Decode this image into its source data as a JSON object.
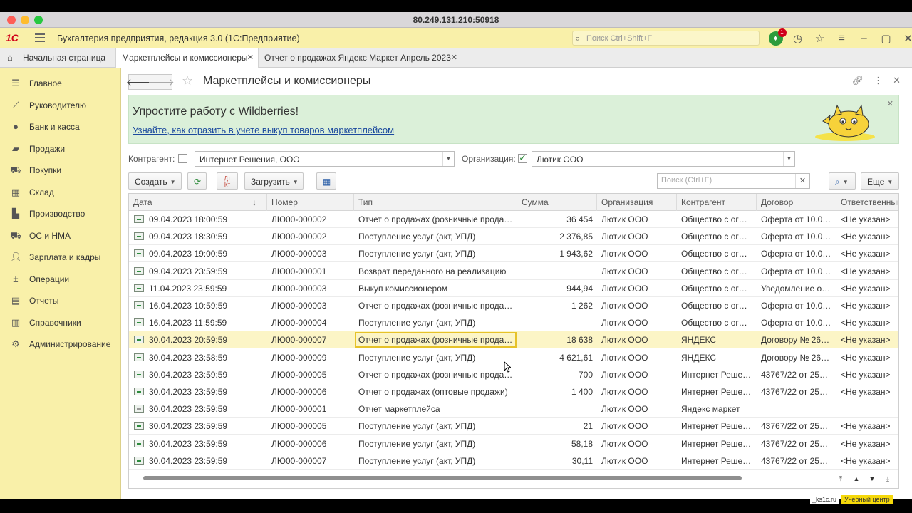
{
  "window": {
    "title": "80.249.131.210:50918"
  },
  "app_header": {
    "logo": "1С",
    "title": "Бухгалтерия предприятия, редакция 3.0  (1С:Предприятие)",
    "search_placeholder": "Поиск Ctrl+Shift+F",
    "notification_count": "1"
  },
  "tabs": [
    {
      "label": "Начальная страница"
    },
    {
      "label": "Маркетплейсы и комиссионеры",
      "close": "✕"
    },
    {
      "label": "Отчет о продажах Яндекс Маркет Апрель 2023",
      "close": "✕"
    }
  ],
  "sidebar": {
    "items": [
      {
        "label": "Главное",
        "icon": "list-icon"
      },
      {
        "label": "Руководителю",
        "icon": "chart-icon"
      },
      {
        "label": "Банк и касса",
        "icon": "coin-icon"
      },
      {
        "label": "Продажи",
        "icon": "bag-icon"
      },
      {
        "label": "Покупки",
        "icon": "cart-icon"
      },
      {
        "label": "Склад",
        "icon": "warehouse-icon"
      },
      {
        "label": "Производство",
        "icon": "factory-icon"
      },
      {
        "label": "ОС и НМА",
        "icon": "truck-icon"
      },
      {
        "label": "Зарплата и кадры",
        "icon": "people-icon"
      },
      {
        "label": "Операции",
        "icon": "dt-kt-icon"
      },
      {
        "label": "Отчеты",
        "icon": "report-icon"
      },
      {
        "label": "Справочники",
        "icon": "book-icon"
      },
      {
        "label": "Администрирование",
        "icon": "gear-icon"
      }
    ]
  },
  "page": {
    "title": "Маркетплейсы и комиссионеры",
    "banner": {
      "title": "Упростите работу с Wildberries!",
      "link": "Узнайте, как отразить в учете выкуп товаров маркетплейсом"
    },
    "filters": {
      "counterparty_label": "Контрагент:",
      "counterparty_value": "Интернет Решения, ООО",
      "organization_label": "Организация:",
      "organization_value": "Лютик ООО"
    },
    "toolbar": {
      "create": "Создать",
      "load": "Загрузить",
      "search_placeholder": "Поиск (Ctrl+F)",
      "more": "Еще"
    }
  },
  "table": {
    "columns": [
      "Дата",
      "Номер",
      "Тип",
      "Сумма",
      "Организация",
      "Контрагент",
      "Договор",
      "Ответственный"
    ],
    "rows": [
      {
        "date": "09.04.2023 18:00:59",
        "num": "ЛЮ00-000002",
        "type": "Отчет о продажах (розничные прода…",
        "sum": "36 454",
        "org": "Лютик ООО",
        "cp": "Общество с ог…",
        "contract": "Оферта от 10.0…",
        "resp": "<Не указан>"
      },
      {
        "date": "09.04.2023 18:30:59",
        "num": "ЛЮ00-000002",
        "type": "Поступление услуг (акт, УПД)",
        "sum": "2 376,85",
        "org": "Лютик ООО",
        "cp": "Общество с ог…",
        "contract": "Оферта от 10.0…",
        "resp": "<Не указан>"
      },
      {
        "date": "09.04.2023 19:00:59",
        "num": "ЛЮ00-000003",
        "type": "Поступление услуг (акт, УПД)",
        "sum": "1 943,62",
        "org": "Лютик ООО",
        "cp": "Общество с ог…",
        "contract": "Оферта от 10.0…",
        "resp": "<Не указан>"
      },
      {
        "date": "09.04.2023 23:59:59",
        "num": "ЛЮ00-000001",
        "type": "Возврат переданного на реализацию",
        "sum": "",
        "org": "Лютик ООО",
        "cp": "Общество с ог…",
        "contract": "Оферта от 10.0…",
        "resp": "<Не указан>"
      },
      {
        "date": "11.04.2023 23:59:59",
        "num": "ЛЮ00-000003",
        "type": "Выкуп комиссионером",
        "sum": "944,94",
        "org": "Лютик ООО",
        "cp": "Общество с ог…",
        "contract": "Уведомление о…",
        "resp": "<Не указан>"
      },
      {
        "date": "16.04.2023 10:59:59",
        "num": "ЛЮ00-000003",
        "type": "Отчет о продажах (розничные прода…",
        "sum": "1 262",
        "org": "Лютик ООО",
        "cp": "Общество с ог…",
        "contract": "Оферта от 10.0…",
        "resp": "<Не указан>"
      },
      {
        "date": "16.04.2023 11:59:59",
        "num": "ЛЮ00-000004",
        "type": "Поступление услуг (акт, УПД)",
        "sum": "",
        "org": "Лютик ООО",
        "cp": "Общество с ог…",
        "contract": "Оферта от 10.0…",
        "resp": "<Не указан>"
      },
      {
        "date": "30.04.2023 20:59:59",
        "num": "ЛЮ00-000007",
        "type": "Отчет о продажах (розничные прода…",
        "sum": "18 638",
        "org": "Лютик ООО",
        "cp": "ЯНДЕКС",
        "contract": "Договору № 26…",
        "resp": "<Не указан>"
      },
      {
        "date": "30.04.2023 23:58:59",
        "num": "ЛЮ00-000009",
        "type": "Поступление услуг (акт, УПД)",
        "sum": "4 621,61",
        "org": "Лютик ООО",
        "cp": "ЯНДЕКС",
        "contract": "Договору № 26…",
        "resp": "<Не указан>"
      },
      {
        "date": "30.04.2023 23:59:59",
        "num": "ЛЮ00-000005",
        "type": "Отчет о продажах (розничные прода…",
        "sum": "700",
        "org": "Лютик ООО",
        "cp": "Интернет Реше…",
        "contract": "43767/22 от 25…",
        "resp": "<Не указан>"
      },
      {
        "date": "30.04.2023 23:59:59",
        "num": "ЛЮ00-000006",
        "type": "Отчет о продажах (оптовые продажи)",
        "sum": "1 400",
        "org": "Лютик ООО",
        "cp": "Интернет Реше…",
        "contract": "43767/22 от 25…",
        "resp": "<Не указан>"
      },
      {
        "date": "30.04.2023 23:59:59",
        "num": "ЛЮ00-000001",
        "type": "Отчет маркетплейса",
        "sum": "",
        "org": "Лютик ООО",
        "cp": "Яндекс маркет",
        "contract": "",
        "resp": ""
      },
      {
        "date": "30.04.2023 23:59:59",
        "num": "ЛЮ00-000005",
        "type": "Поступление услуг (акт, УПД)",
        "sum": "21",
        "org": "Лютик ООО",
        "cp": "Интернет Реше…",
        "contract": "43767/22 от 25…",
        "resp": "<Не указан>"
      },
      {
        "date": "30.04.2023 23:59:59",
        "num": "ЛЮ00-000006",
        "type": "Поступление услуг (акт, УПД)",
        "sum": "58,18",
        "org": "Лютик ООО",
        "cp": "Интернет Реше…",
        "contract": "43767/22 от 25…",
        "resp": "<Не указан>"
      },
      {
        "date": "30.04.2023 23:59:59",
        "num": "ЛЮ00-000007",
        "type": "Поступление услуг (акт, УПД)",
        "sum": "30,11",
        "org": "Лютик ООО",
        "cp": "Интернет Реше…",
        "contract": "43767/22 от 25…",
        "resp": "<Не указан>"
      }
    ]
  },
  "watermark": {
    "site": "_ks1c.ru",
    "label": "Учебный центр"
  }
}
